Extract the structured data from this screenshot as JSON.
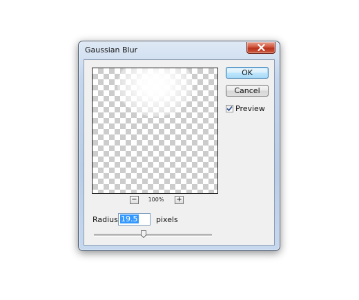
{
  "window": {
    "title": "Gaussian Blur",
    "close_icon": "close-x-icon"
  },
  "preview": {
    "zoom_level": "100%",
    "zoom_out_label": "−",
    "zoom_in_label": "+"
  },
  "buttons": {
    "ok_label": "OK",
    "cancel_label": "Cancel"
  },
  "preview_toggle": {
    "label": "Preview",
    "checked": true
  },
  "radius": {
    "label": "Radius:",
    "value": "19.5",
    "unit": "pixels"
  },
  "slider": {
    "level": 0.42
  }
}
